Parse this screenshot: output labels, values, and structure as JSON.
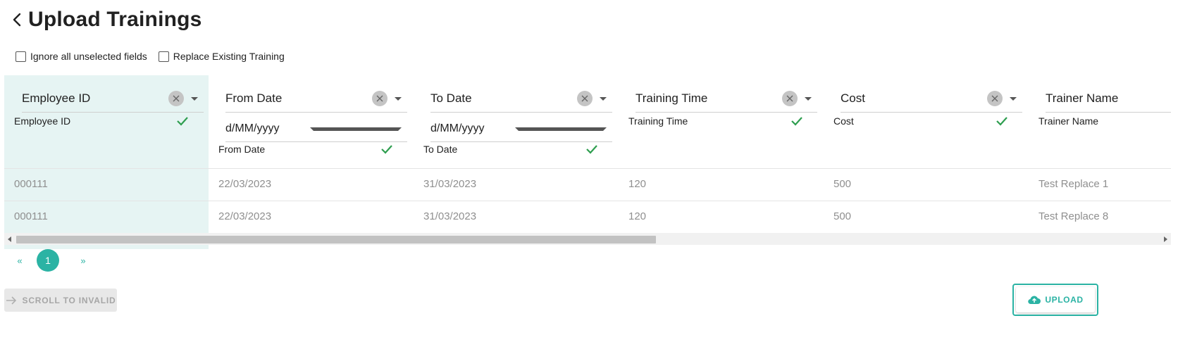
{
  "header": {
    "title": "Upload Trainings",
    "back_icon": "chevron-left-icon"
  },
  "options": {
    "ignore_unselected": {
      "label": "Ignore all unselected fields",
      "checked": false
    },
    "replace_existing": {
      "label": "Replace Existing Training",
      "checked": false
    }
  },
  "columns": [
    {
      "mapping": "Employee ID",
      "source": "Employee ID",
      "format": null,
      "valid": true
    },
    {
      "mapping": "From Date",
      "source": "From Date",
      "format": "d/MM/yyyy",
      "valid": true
    },
    {
      "mapping": "To Date",
      "source": "To Date",
      "format": "d/MM/yyyy",
      "valid": true
    },
    {
      "mapping": "Training Time",
      "source": "Training Time",
      "format": null,
      "valid": true
    },
    {
      "mapping": "Cost",
      "source": "Cost",
      "format": null,
      "valid": true
    },
    {
      "mapping": "Trainer Name",
      "source": "Trainer Name",
      "format": null,
      "valid": true
    }
  ],
  "rows": [
    [
      "000111",
      "22/03/2023",
      "31/03/2023",
      "120",
      "500",
      "Test Replace 1"
    ],
    [
      "000111",
      "22/03/2023",
      "31/03/2023",
      "120",
      "500",
      "Test Replace 8"
    ]
  ],
  "pagination": {
    "prev": "«",
    "current": "1",
    "next": "»"
  },
  "buttons": {
    "scroll_invalid": "SCROLL TO INVALID",
    "upload": "UPLOAD"
  },
  "colors": {
    "accent": "#2bb3a4",
    "valid_check": "#2e9e4f",
    "first_column_bg": "#e6f4f3"
  }
}
